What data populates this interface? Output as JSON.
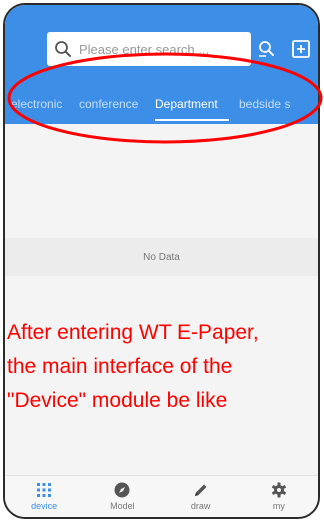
{
  "search": {
    "placeholder": "Please enter search ..."
  },
  "tabs": [
    {
      "label": "electronic",
      "active": false
    },
    {
      "label": "conference",
      "active": false
    },
    {
      "label": "Department",
      "active": true
    },
    {
      "label": "bedside s",
      "active": false
    }
  ],
  "empty_state": {
    "text": "No Data"
  },
  "caption": {
    "line1": "After entering WT E-Paper,",
    "line2": "the main interface of the",
    "line3": "\"Device\" module be like"
  },
  "bottom_nav": [
    {
      "label": "device",
      "icon": "grid-icon",
      "active": true
    },
    {
      "label": "Model",
      "icon": "compass-icon",
      "active": false
    },
    {
      "label": "draw",
      "icon": "pencil-icon",
      "active": false
    },
    {
      "label": "my",
      "icon": "gear-icon",
      "active": false
    }
  ],
  "colors": {
    "header_blue": "#3d8ee6",
    "annotation_red": "#ff0000"
  }
}
